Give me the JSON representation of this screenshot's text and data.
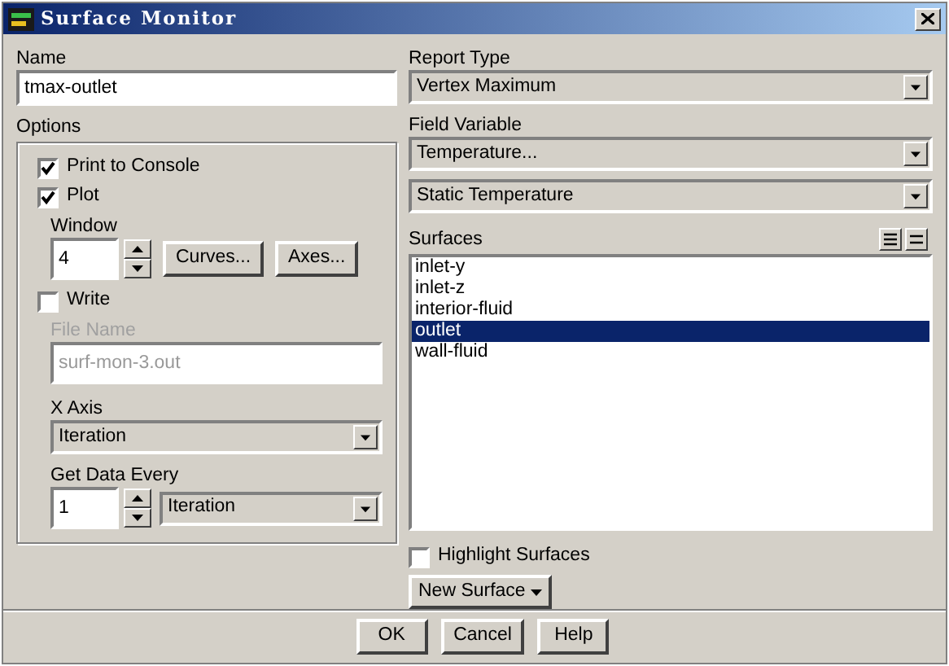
{
  "window": {
    "title": "Surface Monitor"
  },
  "name": {
    "label": "Name",
    "value": "tmax-outlet"
  },
  "options": {
    "label": "Options",
    "print_to_console": {
      "label": "Print to Console",
      "checked": true
    },
    "plot": {
      "label": "Plot",
      "checked": true
    },
    "window": {
      "label": "Window",
      "value": "4"
    },
    "buttons": [
      "Curves...",
      "Axes..."
    ],
    "write": {
      "label": "Write",
      "checked": false
    },
    "file_name": {
      "label": "File Name",
      "value": "surf-mon-3.out",
      "disabled": true
    },
    "x_axis": {
      "label": "X Axis",
      "value": "Iteration"
    },
    "get_data_every": {
      "label": "Get Data Every",
      "value": "1",
      "unit": "Iteration"
    }
  },
  "report_type": {
    "label": "Report Type",
    "value": "Vertex Maximum"
  },
  "field_variable": {
    "label": "Field Variable",
    "category": "Temperature...",
    "value": "Static Temperature"
  },
  "surfaces": {
    "label": "Surfaces",
    "items": [
      {
        "label": "inlet-y",
        "selected": false
      },
      {
        "label": "inlet-z",
        "selected": false
      },
      {
        "label": "interior-fluid",
        "selected": false
      },
      {
        "label": "outlet",
        "selected": true
      },
      {
        "label": "wall-fluid",
        "selected": false
      }
    ]
  },
  "highlight_surfaces": {
    "label": "Highlight Surfaces",
    "checked": false
  },
  "new_surface": {
    "label": "New Surface"
  },
  "buttons": [
    "OK",
    "Cancel",
    "Help"
  ]
}
